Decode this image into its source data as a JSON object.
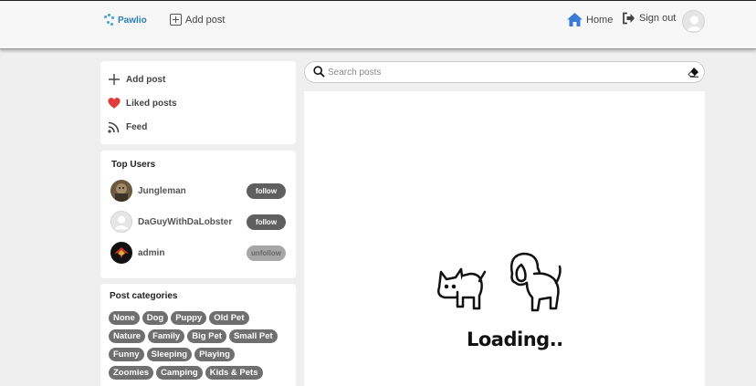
{
  "navbar": {
    "brand": "Pawlio",
    "add_post": "Add post",
    "home": "Home",
    "sign_out": "Sign out"
  },
  "menu": {
    "items": [
      {
        "label": "Add post",
        "icon": "plus-icon"
      },
      {
        "label": "Liked posts",
        "icon": "heart-icon"
      },
      {
        "label": "Feed",
        "icon": "rss-feed-icon"
      }
    ]
  },
  "top_users": {
    "title": "Top Users",
    "users": [
      {
        "name": "Jungleman",
        "action": "follow"
      },
      {
        "name": "DaGuyWithDaLobster",
        "action": "follow"
      },
      {
        "name": "admin",
        "action": "unfollow"
      }
    ]
  },
  "categories": {
    "title": "Post categories",
    "rows": [
      [
        "None",
        "Dog",
        "Puppy",
        "Old Pet"
      ],
      [
        "Nature",
        "Family",
        "Big Pet",
        "Small Pet"
      ],
      [
        "Funny",
        "Sleeping",
        "Playing"
      ],
      [
        "Zoomies",
        "Camping",
        "Kids & Pets"
      ]
    ]
  },
  "search": {
    "placeholder": "Search posts"
  },
  "feed": {
    "loading_text": "Loading.."
  },
  "colors": {
    "accent": "#2d7fb8",
    "heart": "#e03c3c",
    "home_icon": "#3a7bd5",
    "tag_bg": "#6f6f6f",
    "follow_bg": "#5f5f5f",
    "unfollow_bg": "#a7a7a7"
  }
}
